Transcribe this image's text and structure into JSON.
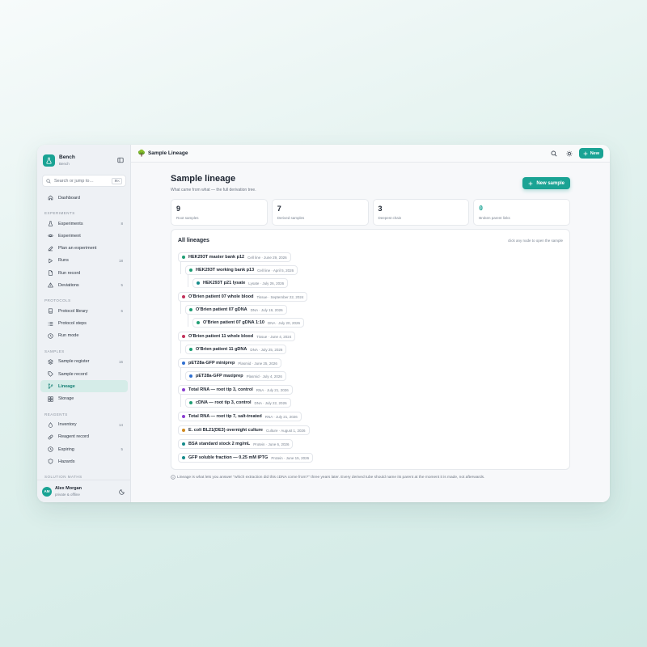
{
  "app": {
    "name": "Bench",
    "workspace": "Bench"
  },
  "search": {
    "placeholder": "Search or jump to…",
    "shortcut": "⌘K"
  },
  "nav": {
    "dashboard": "Dashboard",
    "sections": {
      "experiments": "EXPERIMENTS",
      "protocols": "PROTOCOLS",
      "samples": "SAMPLES",
      "reagents": "REAGENTS",
      "solution_maths": "SOLUTION MATHS"
    },
    "experiments": [
      {
        "label": "Experiments",
        "count": "8"
      },
      {
        "label": "Experiment",
        "count": ""
      },
      {
        "label": "Plan an experiment",
        "count": ""
      },
      {
        "label": "Runs",
        "count": "18"
      },
      {
        "label": "Run record",
        "count": ""
      },
      {
        "label": "Deviations",
        "count": "5"
      }
    ],
    "protocols": [
      {
        "label": "Protocol library",
        "count": "6"
      },
      {
        "label": "Protocol steps",
        "count": ""
      },
      {
        "label": "Run mode",
        "count": ""
      }
    ],
    "samples": [
      {
        "label": "Sample register",
        "count": "16"
      },
      {
        "label": "Sample record",
        "count": ""
      },
      {
        "label": "Lineage",
        "count": ""
      },
      {
        "label": "Storage",
        "count": ""
      }
    ],
    "reagents": [
      {
        "label": "Inventory",
        "count": "14"
      },
      {
        "label": "Reagent record",
        "count": ""
      },
      {
        "label": "Expiring",
        "count": "5"
      },
      {
        "label": "Hazards",
        "count": ""
      }
    ]
  },
  "user": {
    "name": "Alex Morgan",
    "status": "private & offline",
    "initials": "AM"
  },
  "topbar": {
    "crumb": "Sample Lineage",
    "new_label": "New"
  },
  "page": {
    "title": "Sample lineage",
    "subtitle": "What came from what — the full derivation tree.",
    "primary_action": "New sample"
  },
  "stats": [
    {
      "value": "9",
      "label": "Root samples"
    },
    {
      "value": "7",
      "label": "Derived samples"
    },
    {
      "value": "3",
      "label": "Deepest chain"
    },
    {
      "value": "0",
      "label": "Broken parent links"
    }
  ],
  "lineages": {
    "title": "All lineages",
    "hint": "click any node to open the sample",
    "nodes": [
      {
        "name": "HEK293T master bank p12",
        "meta": "Cell line · June 29, 2026",
        "color": "#1f9d74",
        "depth": 0
      },
      {
        "name": "HEK293T working bank p13",
        "meta": "Cell line · April 5, 2026",
        "color": "#1f9d74",
        "depth": 1
      },
      {
        "name": "HEK293T p21 lysate",
        "meta": "Lysate · July 26, 2026",
        "color": "#138a8a",
        "depth": 2
      },
      {
        "name": "O'Brien patient 07 whole blood",
        "meta": "Tissue · September 22, 2024",
        "color": "#c2325b",
        "depth": 0
      },
      {
        "name": "O'Brien patient 07 gDNA",
        "meta": "DNA · July 19, 2026",
        "color": "#1f9d74",
        "depth": 1
      },
      {
        "name": "O'Brien patient 07 gDNA 1:10",
        "meta": "DNA · July 20, 2026",
        "color": "#1f9d74",
        "depth": 2
      },
      {
        "name": "O'Brien patient 11 whole blood",
        "meta": "Tissue · June 4, 2024",
        "color": "#c2325b",
        "depth": 0
      },
      {
        "name": "O'Brien patient 11 gDNA",
        "meta": "DNA · July 25, 2026",
        "color": "#1f9d74",
        "depth": 1
      },
      {
        "name": "pET28a-GFP miniprep",
        "meta": "Plasmid · June 25, 2026",
        "color": "#2f6fd1",
        "depth": 0
      },
      {
        "name": "pET28a-GFP maxiprep",
        "meta": "Plasmid · July 4, 2026",
        "color": "#2f6fd1",
        "depth": 1
      },
      {
        "name": "Total RNA — root tip 3, control",
        "meta": "RNA · July 21, 2026",
        "color": "#8a3fd1",
        "depth": 0
      },
      {
        "name": "cDNA — root tip 3, control",
        "meta": "DNA · July 22, 2026",
        "color": "#1f9d74",
        "depth": 1
      },
      {
        "name": "Total RNA — root tip 7, salt-treated",
        "meta": "RNA · July 21, 2026",
        "color": "#8a3fd1",
        "depth": 0
      },
      {
        "name": "E. coli BL21(DE3) overnight culture",
        "meta": "Culture · August 1, 2026",
        "color": "#d18a1f",
        "depth": 0
      },
      {
        "name": "BSA standard stock 2 mg/mL",
        "meta": "Protein · June 6, 2026",
        "color": "#138a8a",
        "depth": 0
      },
      {
        "name": "GFP soluble fraction — 0.25 mM IPTG",
        "meta": "Protein · June 15, 2026",
        "color": "#138a8a",
        "depth": 0
      }
    ]
  },
  "footnote": "Lineage is what lets you answer \"which extraction did this cDNA come from?\" three years later. Every derived tube should name its parent at the moment it is made, not afterwards."
}
